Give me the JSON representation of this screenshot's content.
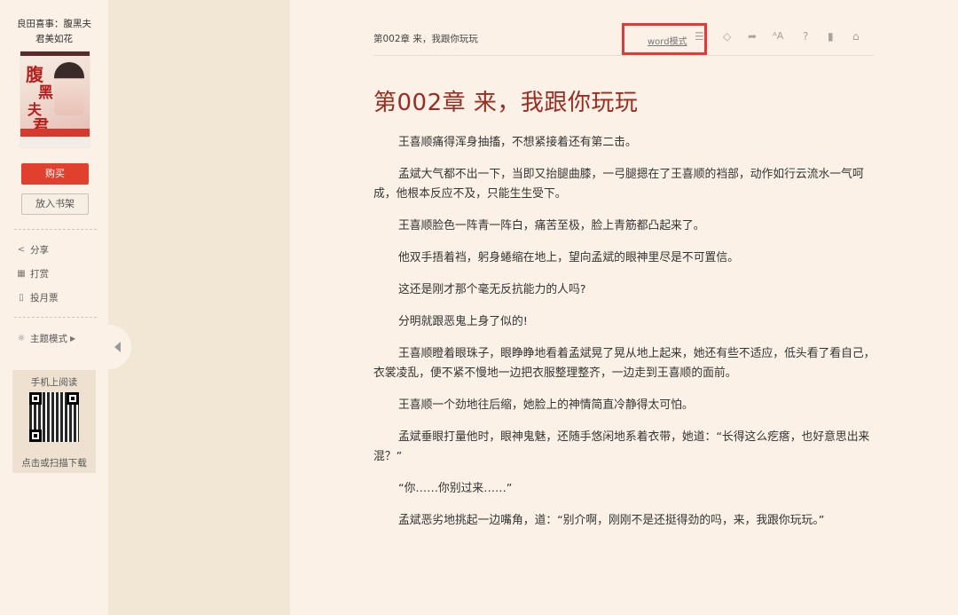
{
  "sidebar": {
    "book_title_line1": "良田喜事：腹黑夫",
    "book_title_line2": "君美如花",
    "buy_label": "购买",
    "shelf_label": "放入书架",
    "share_label": "分享",
    "reward_label": "打赏",
    "vote_label": "投月票",
    "theme_label": "主题模式",
    "mobile_read_label": "手机上阅读",
    "scan_label": "点击或扫描下载"
  },
  "header": {
    "chapter_short": "第002章 来，我跟你玩玩",
    "word_mode_label": "word模式",
    "toolbar_icons": [
      "list-icon",
      "diamond-icon",
      "share-arrow-icon",
      "font-size-icon",
      "help-icon",
      "bookmark-icon",
      "home-icon"
    ]
  },
  "chapter": {
    "title": "第002章 来，我跟你玩玩",
    "paragraphs": [
      "王喜顺痛得浑身抽搐，不想紧接着还有第二击。",
      "孟斌大气都不出一下，当即又抬腿曲膝，一弓腿摁在了王喜顺的裆部，动作如行云流水一气呵成，他根本反应不及，只能生生受下。",
      "王喜顺脸色一阵青一阵白，痛苦至极，脸上青筋都凸起来了。",
      "他双手捂着裆，躬身蜷缩在地上，望向孟斌的眼神里尽是不可置信。",
      "这还是刚才那个毫无反抗能力的人吗?",
      "分明就跟恶鬼上身了似的!",
      "王喜顺瞪着眼珠子，眼睁睁地看着孟斌晃了晃从地上起来，她还有些不适应，低头看了看自己，衣裳凌乱，便不紧不慢地一边把衣服整理整齐，一边走到王喜顺的面前。",
      "王喜顺一个劲地往后缩，她脸上的神情简直冷静得太可怕。",
      "孟斌垂眼打量他时，眼神鬼魅，还随手悠闲地系着衣带，她道：“长得这么疙瘩，也好意思出来混？”",
      "“你……你别过来……”",
      "孟斌恶劣地挑起一边嘴角，道：“别介啊，刚刚不是还挺得劲的吗，来，我跟你玩玩。”"
    ]
  },
  "colors": {
    "accent_red": "#9b2c20",
    "buy_button": "#e0402d",
    "highlight_box": "#e53935",
    "page_bg": "#fbf1e6",
    "outer_bg": "#f2e6d5"
  }
}
